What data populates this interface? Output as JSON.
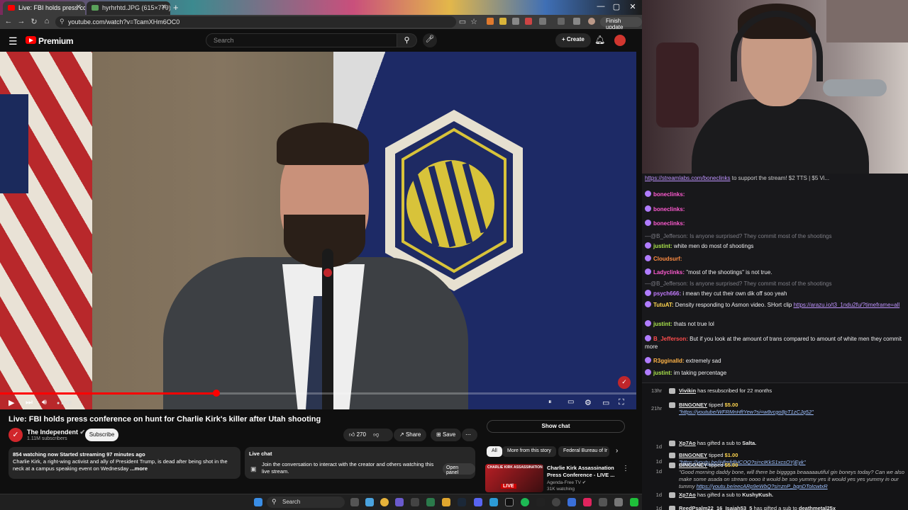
{
  "browser": {
    "tabs": [
      {
        "label": "Live: FBI holds press confe",
        "active": true
      },
      {
        "label": "hyrhrhtd.JPG (615×779)",
        "active": false
      }
    ],
    "url": "youtube.com/watch?v=TcamXHm6OC0",
    "finish_update": "Finish update"
  },
  "youtube": {
    "brand": "Premium",
    "search_placeholder": "Search",
    "create_label": "Create",
    "live_label": "LIVE",
    "progress_fraction": 0.34
  },
  "video_info": {
    "title": "Live: FBI holds press conference on hunt for Charlie Kirk's killer after Utah shooting",
    "channel": "The Independent",
    "subscribers": "1.11M subscribers",
    "subscribe_label": "Subscribe",
    "likes": "270",
    "share_label": "Share",
    "save_label": "Save",
    "stats": "854 watching now  Started streaming 97 minutes ago",
    "description": "Charlie Kirk, a right-wing activist and ally of President Trump, is dead after being shot in the neck at a campus speaking event on Wednesday",
    "more_label": "...more",
    "live_chat_title": "Live chat",
    "live_chat_text": "Join the conversation to interact with the creator and others watching this live stream.",
    "open_panel_label": "Open panel"
  },
  "sidebar": {
    "show_chat_label": "Show chat",
    "chips": [
      "All",
      "More from this story",
      "Federal Bureau of Ir"
    ],
    "related": {
      "thumb_text": "CHARLIE KIRK ASSASSINATION",
      "thumb_live": "LIVE",
      "title": "Charlie Kirk Assassination Press Conference - LIVE ...",
      "channel": "Agenda-Free TV",
      "views": "31K watching"
    }
  },
  "taskbar": {
    "search_label": "Search"
  },
  "chat": {
    "top_link": "https://streamlabs.com/boneclinks",
    "top_text": " to support the stream! $2 TTS | $5 Vi...",
    "messages": [
      {
        "user": "boneclinks:",
        "text": "",
        "color": "#ff5bd1"
      },
      {
        "user": "boneclinks:",
        "text": "",
        "color": "#ff5bd1"
      },
      {
        "user": "boneclinks:",
        "text": "",
        "color": "#ff5bd1"
      },
      {
        "user": "",
        "text": "—@B_Jefferson: Is anyone surprised? They commit most of the shootings",
        "dim": true
      },
      {
        "user": "justint:",
        "text": " white men do most of shootings",
        "color": "#a9e34b"
      },
      {
        "user": "Cloudsurf:",
        "text": "",
        "color": "#ff8c42"
      },
      {
        "user": "Ladyclinks:",
        "text": " \"most of the shootings\" is not true.",
        "color": "#ff5bd1"
      },
      {
        "user": "",
        "text": "—@B_Jefferson: Is anyone surprised? They commit most of the shootings",
        "dim": true
      },
      {
        "user": "psych666:",
        "text": " i mean they cut their own dik off soo yeah",
        "color": "#c47bff"
      },
      {
        "user": "TutuAT:",
        "text": " Density responding to Asmon video. SHort clip ",
        "color": "#ffd54f",
        "link": "https://arazu.io/t3_1ndu2fu/?timeframe=all"
      },
      {
        "user": "justint:",
        "text": " thats not true lol",
        "color": "#a9e34b"
      },
      {
        "user": "B_Jefferson:",
        "text": " But if you look at the amount of trans compared to amount of white men they commit more",
        "color": "#ff4d4d"
      },
      {
        "user": "R3gginalld:",
        "text": " extremely sad",
        "color": "#ffb347"
      },
      {
        "user": "justint:",
        "text": " im taking percentage",
        "color": "#a9e34b"
      }
    ]
  },
  "events": [
    {
      "time": "13hr",
      "html_user": "Vivikin",
      "text": " has resubscribed for 22 months"
    },
    {
      "time": "21hr",
      "html_user": "BINGONEY",
      "text": " tipped ",
      "amount": "$5.00",
      "link": "\"https://youtube/WFRMnHftYew?si=w8vcgo8pT1zCJq52\""
    },
    {
      "time": "1d",
      "html_user": "Xp7Ao",
      "text": " has gifted a sub to ",
      "target": "Salta."
    },
    {
      "time": "1d",
      "html_user": "BINGONEY",
      "text": " tipped ",
      "amount": "$1.00",
      "link": "\"https://youtu.be/iHfmfdlHCOQ?si=cIKkS1xcsOYjEyk\""
    },
    {
      "time": "1d",
      "html_user": "BINGONEY",
      "text": " tipped ",
      "amount": "$5.00",
      "quote": "\"Good morning daddy bone, will there be bigggga beaaaaautiful gin boneys today? Can we also make some asada on stream oooo it would be soo yummy yes it would yes yes yummy in our tummy ",
      "link": "https://youtu.be/eecARp9eWbQ?si=znP_bqnDToIcwtxR"
    },
    {
      "time": "1d",
      "html_user": "Xp7Ao",
      "text": " has gifted a sub to ",
      "target": "KushyKush."
    },
    {
      "time": "1d",
      "html_user": "ReedPsalm22_16_Isaiah53_5",
      "text": " has gifted a sub to ",
      "target": "deathmetal25x"
    }
  ]
}
